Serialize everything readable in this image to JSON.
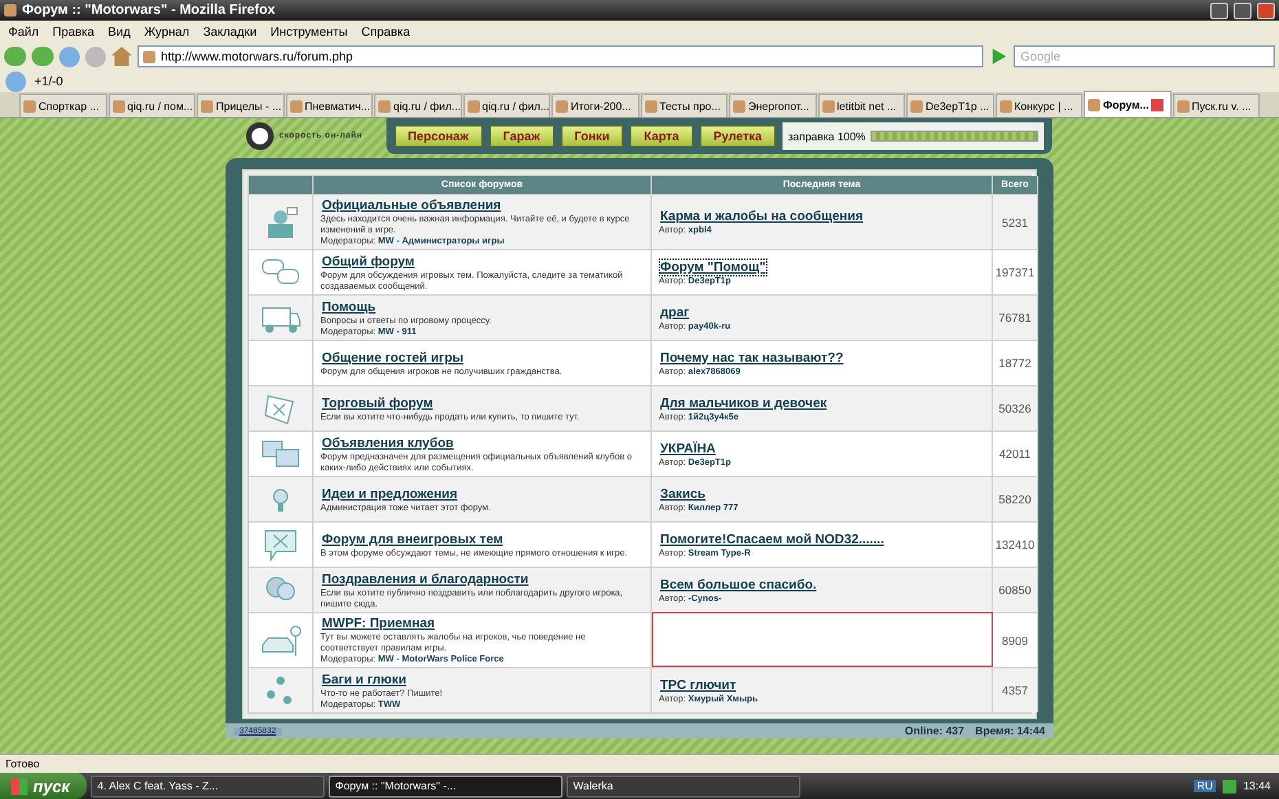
{
  "window": {
    "title": "Форум :: \"Motorwars\" - Mozilla Firefox"
  },
  "menu": [
    "Файл",
    "Правка",
    "Вид",
    "Журнал",
    "Закладки",
    "Инструменты",
    "Справка"
  ],
  "navbar": {
    "url": "http://www.motorwars.ru/forum.php",
    "search_placeholder": "Google"
  },
  "toolbar": {
    "counter": "+1/-0"
  },
  "tabs": [
    {
      "label": "Спорткар ...",
      "selected": false
    },
    {
      "label": "qiq.ru / пом...",
      "selected": false
    },
    {
      "label": "Прицелы - ...",
      "selected": false
    },
    {
      "label": "Пневматич...",
      "selected": false
    },
    {
      "label": "qiq.ru / фил...",
      "selected": false
    },
    {
      "label": "qiq.ru / фил...",
      "selected": false
    },
    {
      "label": "Итоги-200...",
      "selected": false
    },
    {
      "label": "Тесты про...",
      "selected": false
    },
    {
      "label": "Энергопот...",
      "selected": false
    },
    {
      "label": "letitbit net ...",
      "selected": false
    },
    {
      "label": "De3epT1p ...",
      "selected": false
    },
    {
      "label": "Конкурс | ...",
      "selected": false
    },
    {
      "label": "Форум...",
      "selected": true
    },
    {
      "label": "Пуск.ru v. ...",
      "selected": false
    }
  ],
  "page": {
    "tagline": "скорость он-лайн",
    "nav_buttons": [
      "Персонаж",
      "Гараж",
      "Гонки",
      "Карта",
      "Рулетка"
    ],
    "fuel": {
      "label": "заправка 100%",
      "level": 1.0
    }
  },
  "forum_table": {
    "columns": [
      "Список форумов",
      "Последняя тема",
      "Всего"
    ],
    "rows": [
      {
        "title": "Официальные объявления",
        "description": "Здесь находится очень важная информация. Читайте её, и будете в курсе изменений в игре.",
        "moderators_label": "Модераторы:",
        "moderators": "MW - Администраторы игры",
        "last_topic": {
          "title": "Карма и жалобы на сообщения",
          "author_label": "Автор:",
          "author": "xpbl4",
          "focused": false,
          "highlighted": false
        },
        "total": "5231"
      },
      {
        "title": "Общий форум",
        "description": "Форум для обсуждения игровых тем. Пожалуйста, следите за тематикой создаваемых сообщений.",
        "last_topic": {
          "title": "Форум \"Помощ\"",
          "author_label": "Автор:",
          "author": "De3epT1p",
          "focused": true,
          "highlighted": false
        },
        "total": "197371"
      },
      {
        "title": "Помощь",
        "description": "Вопросы и ответы по игровому процессу.",
        "moderators_label": "Модераторы:",
        "moderators": "MW - 911",
        "last_topic": {
          "title": "драг",
          "author_label": "Автор:",
          "author": "pay40k-ru",
          "focused": false,
          "highlighted": false
        },
        "total": "76781"
      },
      {
        "title": "Общение гостей игры",
        "description": "Форум для общения игроков не получивших гражданства.",
        "last_topic": {
          "title": "Почему нас так называют??",
          "author_label": "Автор:",
          "author": "alex7868069",
          "focused": false,
          "highlighted": false
        },
        "total": "18772"
      },
      {
        "title": "Торговый форум",
        "description": "Если вы хотите что-нибудь продать или купить, то пишите тут.",
        "last_topic": {
          "title": "Для мальчиков и девочек",
          "author_label": "Автор:",
          "author": "1й2ц3у4к5е",
          "focused": false,
          "highlighted": false
        },
        "total": "50326"
      },
      {
        "title": "Объявления клубов",
        "description": "Форум предназначен для размещения официальных объявлений клубов о каких-либо действиях или событиях.",
        "last_topic": {
          "title": "УКРАЇНА",
          "author_label": "Автор:",
          "author": "De3epT1p",
          "focused": false,
          "highlighted": false
        },
        "total": "42011"
      },
      {
        "title": "Идеи и предложения",
        "description": "Администрация тоже читает этот форум.",
        "last_topic": {
          "title": "Закись",
          "author_label": "Автор:",
          "author": "Киллер 777",
          "focused": false,
          "highlighted": false
        },
        "total": "58220"
      },
      {
        "title": "Форум для внеигровых тем",
        "description": "В этом форуме обсуждают темы, не имеющие прямого отношения к игре.",
        "last_topic": {
          "title": "Помогите!Спасаем мой NOD32.......",
          "author_label": "Автор:",
          "author": "Stream Type-R",
          "focused": false,
          "highlighted": false
        },
        "total": "132410"
      },
      {
        "title": "Поздравления и благодарности",
        "description": "Если вы хотите публично поздравить или поблагодарить другого игрока, пишите сюда.",
        "last_topic": {
          "title": "Всем большое спасибо.",
          "author_label": "Автор:",
          "author": "-Cynos-",
          "focused": false,
          "highlighted": false
        },
        "total": "60850"
      },
      {
        "title": "MWPF: Приемная",
        "description": "Тут вы можете оставлять жалобы на игроков, чье поведение не соответствует правилам игры.",
        "moderators_label": "Модераторы:",
        "moderators": "MW - MotorWars Police Force",
        "last_topic": {
          "highlighted": true
        },
        "total": "8909"
      },
      {
        "title": "Баги и глюки",
        "description": "Что-то не работает? Пишите!",
        "moderators_label": "Модераторы:",
        "moderators": "TWW",
        "last_topic": {
          "title": "TPC глючит",
          "author_label": "Автор:",
          "author": "Хмурый Хмырь",
          "focused": false,
          "highlighted": false
        },
        "total": "4357"
      }
    ]
  },
  "footer": {
    "counter": "37485832",
    "online": "Online: 437",
    "time": "Время: 14:44"
  },
  "status_bar": {
    "text": "Готово"
  },
  "taskbar": {
    "start": "пуск",
    "tasks": [
      {
        "label": "4. Alex C feat. Yass - Z...",
        "selected": false
      },
      {
        "label": "Форум :: \"Motorwars\" -...",
        "selected": true
      },
      {
        "label": "Walerka",
        "selected": false
      }
    ],
    "language": "RU",
    "clock": "13:44"
  }
}
